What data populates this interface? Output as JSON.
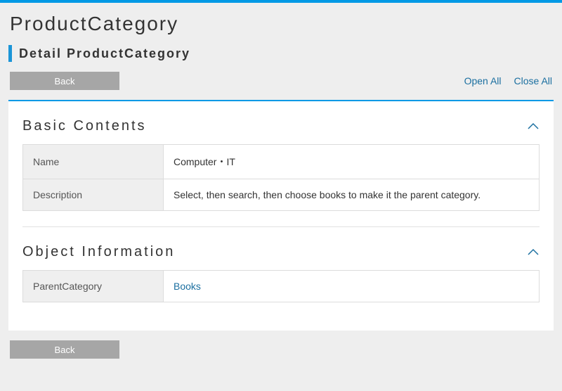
{
  "page": {
    "title": "ProductCategory",
    "subtitle": "Detail ProductCategory"
  },
  "toolbar": {
    "back_label": "Back",
    "open_all_label": "Open All",
    "close_all_label": "Close All"
  },
  "sections": {
    "basic": {
      "title": "Basic Contents",
      "fields": {
        "name_label": "Name",
        "name_value": "Computer・IT",
        "description_label": "Description",
        "description_value": "Select, then search, then choose books to make it the parent category."
      }
    },
    "object": {
      "title": "Object Information",
      "fields": {
        "parent_label": "ParentCategory",
        "parent_value": "Books"
      }
    }
  },
  "bottom": {
    "back_label": "Back"
  }
}
